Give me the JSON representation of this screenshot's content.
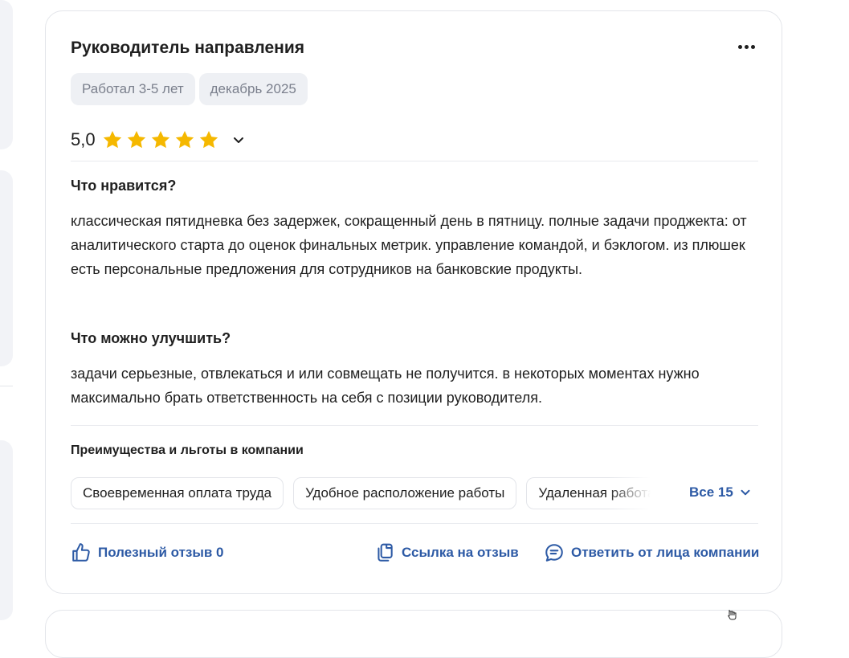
{
  "review": {
    "title": "Руководитель направления",
    "tags": [
      "Работал 3-5 лет",
      "декабрь 2025"
    ],
    "rating": "5,0",
    "stars": 5,
    "likes": {
      "heading": "Что нравится?",
      "text": "классическая пятидневка без задержек, сокращенный день в пятницу. полные задачи проджекта: от аналитического старта до оценок финальных метрик. управление командой, и бэклогом. из плюшек есть персональные предложения для сотрудников на банковские продукты."
    },
    "improve": {
      "heading": "Что можно улучшить?",
      "text": "задачи серьезные, отвлекаться и или совмещать не получится. в некоторых моментах нужно максимально брать ответственность на себя с позиции руководителя."
    },
    "benefits": {
      "heading": "Преимущества и льготы в компании",
      "chips": [
        "Своевременная оплата труда",
        "Удобное расположение работы",
        "Удаленная работа"
      ],
      "all_label": "Все 15"
    },
    "actions": {
      "helpful": "Полезный отзыв 0",
      "link": "Ссылка на отзыв",
      "reply": "Ответить от лица компании"
    }
  },
  "colors": {
    "accent": "#2d5aa5",
    "star": "#f5b800",
    "tag_bg": "#eef0f4",
    "tag_text": "#7a7f8c",
    "border": "#e3e5ea"
  },
  "icons": {
    "more": "more-horizontal-icon",
    "star": "star-icon",
    "chevron": "chevron-down-icon",
    "like": "thumbs-up-icon",
    "copy": "copy-link-icon",
    "reply": "chat-bubble-icon"
  }
}
